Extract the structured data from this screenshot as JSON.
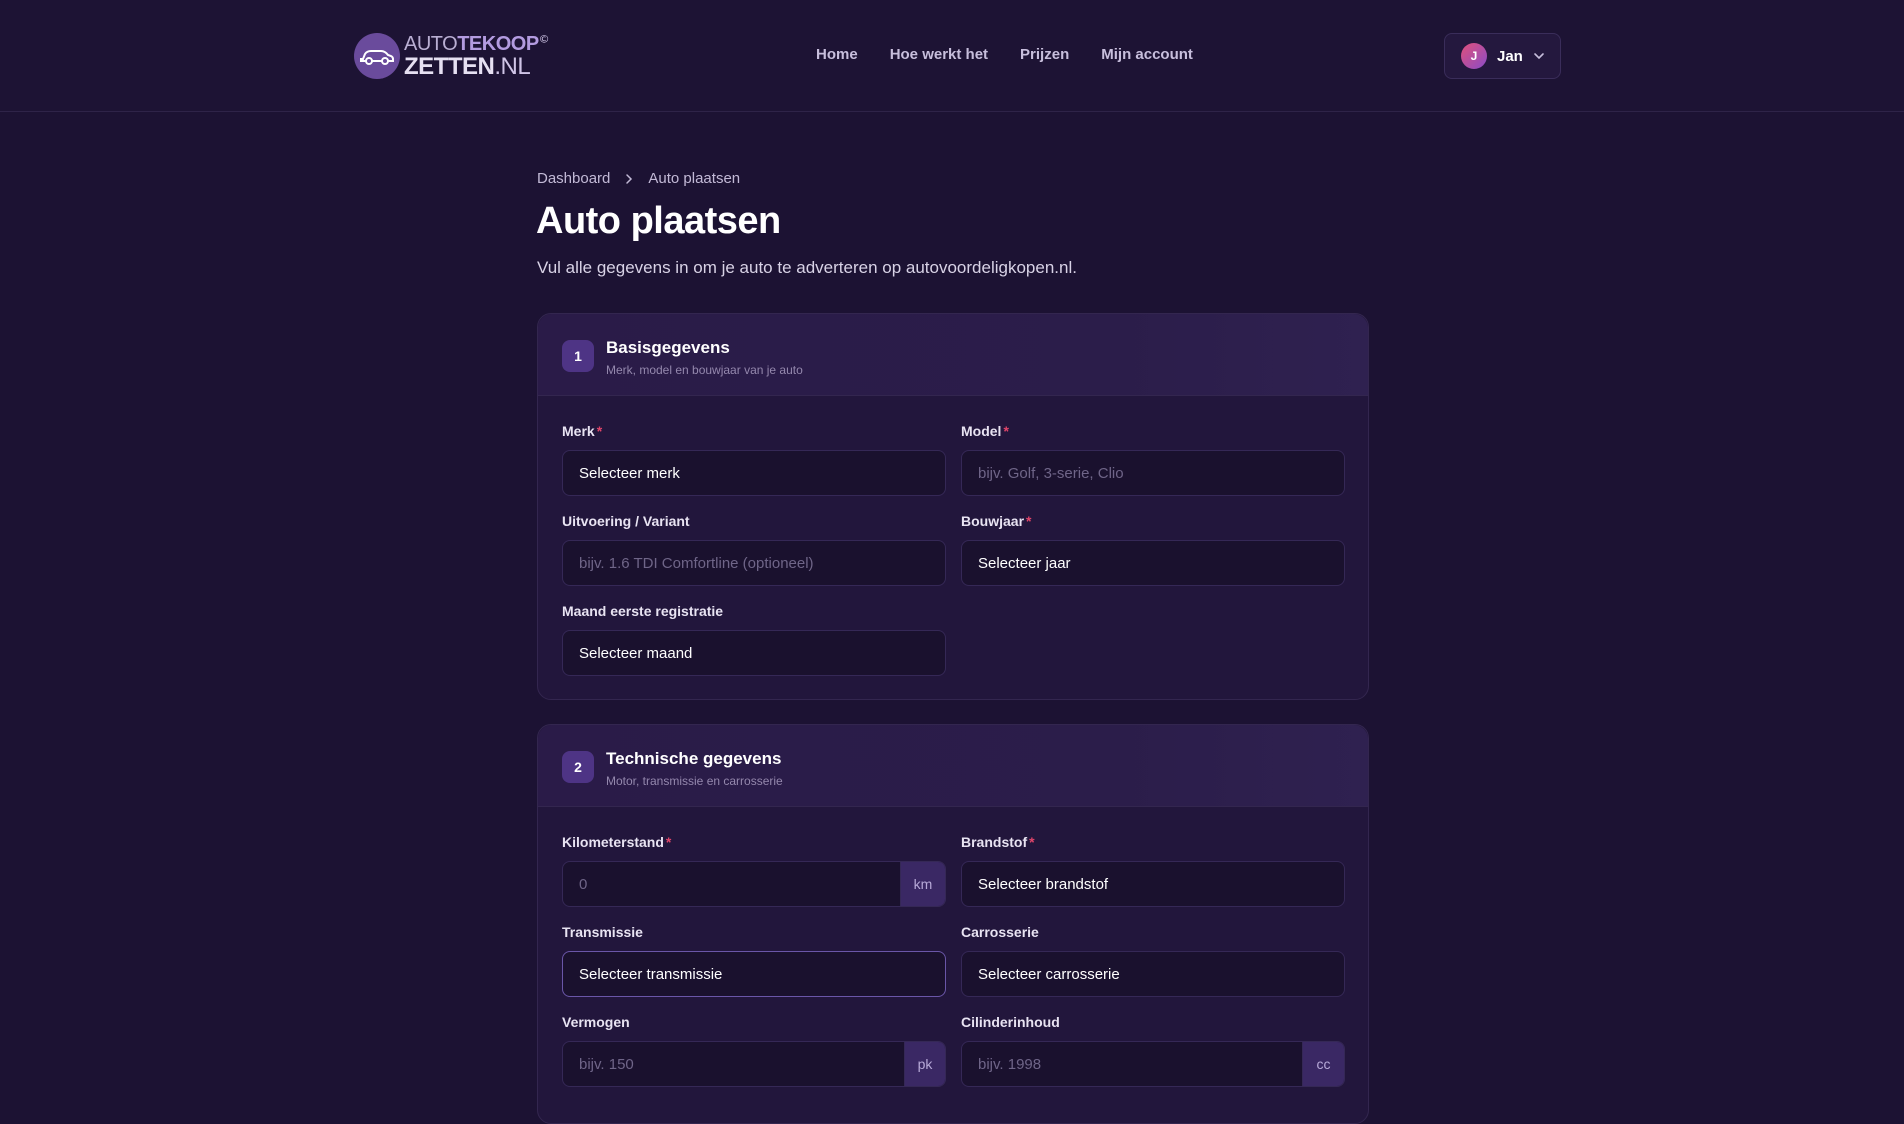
{
  "header": {
    "logo": {
      "line1_thin": "AUTO",
      "line1_bold": "TEKOOP",
      "registered": "©",
      "line2_bold": "ZETTEN",
      "line2_thin": ".NL"
    },
    "nav": [
      "Home",
      "Hoe werkt het",
      "Prijzen",
      "Mijn account"
    ],
    "user": {
      "initial": "J",
      "name": "Jan"
    }
  },
  "breadcrumb": {
    "items": [
      "Dashboard",
      "Auto plaatsen"
    ]
  },
  "page": {
    "title": "Auto plaatsen",
    "subtitle": "Vul alle gegevens in om je auto te adverteren op autovoordeligkopen.nl."
  },
  "sections": [
    {
      "number": "1",
      "title": "Basisgegevens",
      "subtitle": "Merk, model en bouwjaar van je auto",
      "fields": {
        "merk": {
          "label": "Merk",
          "required": "*",
          "value": "Selecteer merk"
        },
        "model": {
          "label": "Model",
          "required": "*",
          "placeholder": "bijv. Golf, 3-serie, Clio"
        },
        "uitvoering": {
          "label": "Uitvoering / Variant",
          "placeholder": "bijv. 1.6 TDI Comfortline (optioneel)"
        },
        "bouwjaar": {
          "label": "Bouwjaar",
          "required": "*",
          "value": "Selecteer jaar"
        },
        "maand": {
          "label": "Maand eerste registratie",
          "value": "Selecteer maand"
        }
      }
    },
    {
      "number": "2",
      "title": "Technische gegevens",
      "subtitle": "Motor, transmissie en carrosserie",
      "fields": {
        "kilometerstand": {
          "label": "Kilometerstand",
          "required": "*",
          "placeholder": "0",
          "unit": "km"
        },
        "brandstof": {
          "label": "Brandstof",
          "required": "*",
          "value": "Selecteer brandstof"
        },
        "transmissie": {
          "label": "Transmissie",
          "value": "Selecteer transmissie"
        },
        "carrosserie": {
          "label": "Carrosserie",
          "value": "Selecteer carrosserie"
        },
        "vermogen": {
          "label": "Vermogen",
          "placeholder": "bijv. 150",
          "unit": "pk"
        },
        "cilinderinhoud": {
          "label": "Cilinderinhoud",
          "placeholder": "bijv. 1998",
          "unit": "cc"
        }
      }
    }
  ],
  "colors": {
    "background": "#1c1233",
    "card": "#22163c",
    "accent": "#4e3485",
    "required": "#e0456a"
  }
}
